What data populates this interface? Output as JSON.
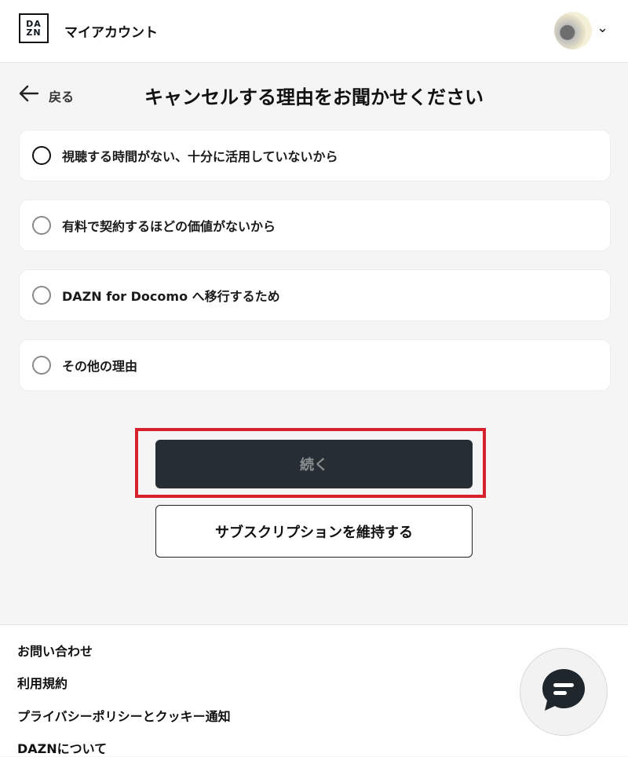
{
  "header": {
    "logo_top": "DA",
    "logo_bottom": "ZN",
    "title": "マイアカウント",
    "chevron": "⌄"
  },
  "nav": {
    "back_label": "戻る"
  },
  "page": {
    "title": "キャンセルする理由をお聞かせください"
  },
  "options": [
    {
      "label": "視聴する時間がない、十分に活用していないから",
      "selected": false
    },
    {
      "label": "有料で契約するほどの価値がないから",
      "selected": false
    },
    {
      "label": "DAZN for Docomo へ移行するため",
      "selected": false
    },
    {
      "label": "その他の理由",
      "selected": false
    }
  ],
  "buttons": {
    "continue": "続く",
    "keep": "サブスクリプションを維持する"
  },
  "footer": {
    "links": [
      "お問い合わせ",
      "利用規約",
      "プライバシーポリシーとクッキー通知",
      "DAZNについて"
    ]
  },
  "icons": {
    "back": "arrow-left-icon",
    "chat": "chat-bubble-icon",
    "chevron": "chevron-down-icon"
  },
  "colors": {
    "highlight": "#d6202d",
    "continue_bg": "#262d33",
    "page_bg": "#f5f5f5"
  }
}
